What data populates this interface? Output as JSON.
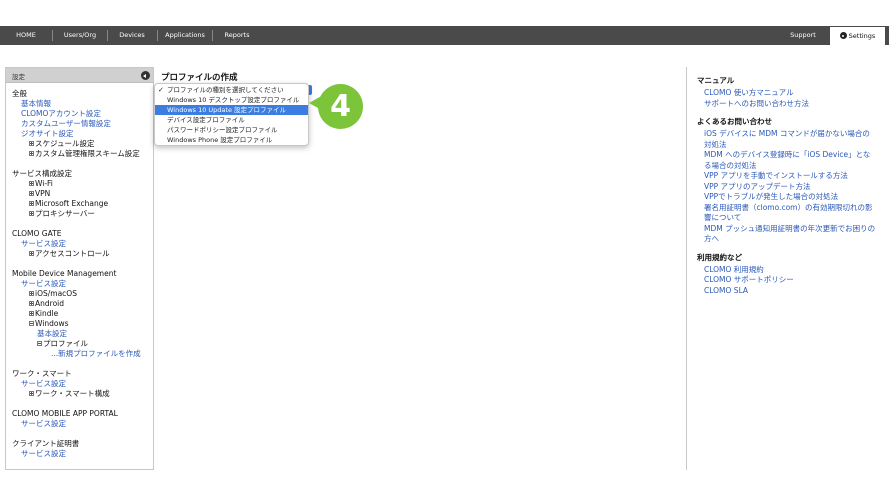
{
  "nav": {
    "items": [
      "HOME",
      "Users/Org",
      "Devices",
      "Applications",
      "Reports"
    ],
    "support": "Support",
    "settings": "Settings"
  },
  "sidebar": {
    "header": "設定",
    "sections": [
      {
        "title": "全般",
        "rows": [
          {
            "text": "基本情報",
            "kind": "link",
            "indent": 1
          },
          {
            "text": "CLOMOアカウント設定",
            "kind": "link",
            "indent": 1
          },
          {
            "text": "カスタムユーザー情報設定",
            "kind": "link",
            "indent": 1
          },
          {
            "text": "ジオサイト設定",
            "kind": "link",
            "indent": 1
          },
          {
            "text": "スケジュール設定",
            "kind": "tree",
            "indent": 2,
            "box": "plus"
          },
          {
            "text": "カスタム管理権限スキーム設定",
            "kind": "tree",
            "indent": 2,
            "box": "plus"
          }
        ]
      },
      {
        "title": "サービス構成設定",
        "rows": [
          {
            "text": "Wi-Fi",
            "kind": "tree",
            "indent": 2,
            "box": "plus"
          },
          {
            "text": "VPN",
            "kind": "tree",
            "indent": 2,
            "box": "plus"
          },
          {
            "text": "Microsoft Exchange",
            "kind": "tree",
            "indent": 2,
            "box": "plus"
          },
          {
            "text": "プロキシサーバー",
            "kind": "tree",
            "indent": 2,
            "box": "plus"
          }
        ]
      },
      {
        "title": "CLOMO GATE",
        "rows": [
          {
            "text": "サービス設定",
            "kind": "link",
            "indent": 1
          },
          {
            "text": "アクセスコントロール",
            "kind": "tree",
            "indent": 2,
            "box": "plus"
          }
        ]
      },
      {
        "title": "Mobile Device Management",
        "rows": [
          {
            "text": "サービス設定",
            "kind": "link",
            "indent": 1
          },
          {
            "text": "iOS/macOS",
            "kind": "tree",
            "indent": 2,
            "box": "plus"
          },
          {
            "text": "Android",
            "kind": "tree",
            "indent": 2,
            "box": "plus"
          },
          {
            "text": "Kindle",
            "kind": "tree",
            "indent": 2,
            "box": "plus"
          },
          {
            "text": "Windows",
            "kind": "tree",
            "indent": 2,
            "box": "minus"
          },
          {
            "text": "基本設定",
            "kind": "link",
            "indent": 3
          },
          {
            "text": "プロファイル",
            "kind": "tree",
            "indent": 3,
            "box": "minus"
          },
          {
            "text": "...新規プロファイルを作成",
            "kind": "link",
            "indent": 4
          }
        ]
      },
      {
        "title": "ワーク・スマート",
        "rows": [
          {
            "text": "サービス設定",
            "kind": "link",
            "indent": 1
          },
          {
            "text": "ワーク・スマート構成",
            "kind": "tree",
            "indent": 2,
            "box": "plus"
          }
        ]
      },
      {
        "title": "CLOMO MOBILE APP PORTAL",
        "rows": [
          {
            "text": "サービス設定",
            "kind": "link",
            "indent": 1
          }
        ]
      },
      {
        "title": "クライアント証明書",
        "rows": [
          {
            "text": "サービス設定",
            "kind": "link",
            "indent": 1
          }
        ]
      }
    ]
  },
  "main": {
    "title": "プロファイルの作成",
    "dropdown": [
      {
        "text": "プロファイルの種別を選択してください",
        "checked": true,
        "selected": false
      },
      {
        "text": "Windows 10 デスクトップ設定プロファイル",
        "checked": false,
        "selected": false
      },
      {
        "text": "Windows 10 Update 設定プロファイル",
        "checked": false,
        "selected": true
      },
      {
        "text": "デバイス設定プロファイル",
        "checked": false,
        "selected": false
      },
      {
        "text": "パスワードポリシー設定プロファイル",
        "checked": false,
        "selected": false
      },
      {
        "text": "Windows Phone 設定プロファイル",
        "checked": false,
        "selected": false
      }
    ],
    "callout": "4"
  },
  "right_panel": {
    "groups": [
      {
        "title": "マニュアル",
        "links": [
          "CLOMO 使い方マニュアル",
          "サポートへのお問い合わせ方法"
        ]
      },
      {
        "title": "よくあるお問い合わせ",
        "links": [
          "iOS デバイスに MDM コマンドが届かない場合の対処法",
          "MDM へのデバイス登録時に「iOS Device」となる場合の対処法",
          "VPP アプリを手動でインストールする方法",
          "VPP アプリのアップデート方法",
          "VPPでトラブルが発生した場合の対処法",
          "署名用証明書（clomo.com）の有効期限切れの影響について",
          "MDM プッシュ通知用証明書の年次更新でお困りの方へ"
        ]
      },
      {
        "title": "利用規約など",
        "links": [
          "CLOMO 利用規約",
          "CLOMO サポートポリシー",
          "CLOMO SLA"
        ]
      }
    ]
  },
  "colors": {
    "accent": "#3b7de0",
    "callout": "#7cc53a",
    "link": "#2a58b8",
    "navbar": "#4a4a4a"
  }
}
